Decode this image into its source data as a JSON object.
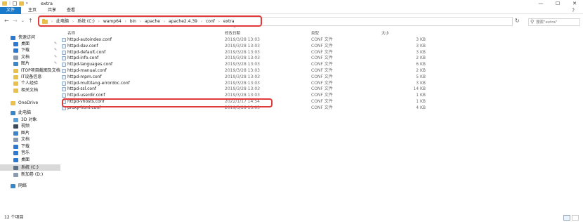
{
  "window": {
    "title": "extra",
    "buttons": {
      "minimize": "—",
      "maximize": "☐",
      "close": "✕"
    }
  },
  "ribbon": {
    "tabs": [
      "文件",
      "主页",
      "共享",
      "查看"
    ],
    "help": "?"
  },
  "nav": {
    "back": "←",
    "forward": "→",
    "dropdown": "⌄",
    "up": "↑",
    "refresh": "↻"
  },
  "address": {
    "crumbs": [
      "此电脑",
      "系统 (C:)",
      "wamp64",
      "bin",
      "apache",
      "apache2.4.39",
      "conf",
      "extra"
    ],
    "sep": "›"
  },
  "search": {
    "placeholder": "搜索\"extra\""
  },
  "sidebar": {
    "items": [
      {
        "label": "快速访问",
        "icon": "star-icon",
        "color": "#2b79d0",
        "pinned": false
      },
      {
        "label": "桌面",
        "icon": "desktop-icon",
        "color": "#2b79d0",
        "pinned": true
      },
      {
        "label": "下载",
        "icon": "download-icon",
        "color": "#2b79d0",
        "pinned": true
      },
      {
        "label": "文档",
        "icon": "document-icon",
        "color": "#8a9bb0",
        "pinned": true
      },
      {
        "label": "图片",
        "icon": "pictures-icon",
        "color": "#3a86c8",
        "pinned": true
      },
      {
        "label": "ITOP项目截图及文档",
        "icon": "folder-icon",
        "color": "#e8c04a",
        "pinned": false
      },
      {
        "label": "IT设备信息",
        "icon": "folder-icon",
        "color": "#e8c04a",
        "pinned": false
      },
      {
        "label": "个人经验",
        "icon": "folder-icon",
        "color": "#e8c04a",
        "pinned": false
      },
      {
        "label": "相关文档",
        "icon": "folder-icon",
        "color": "#e8c04a",
        "pinned": false
      },
      {
        "label": "OneDrive",
        "icon": "onedrive-icon",
        "color": "#e8c04a",
        "pinned": false
      },
      {
        "label": "此电脑",
        "icon": "computer-icon",
        "color": "#3a86c8",
        "pinned": false
      },
      {
        "label": "3D 对象",
        "icon": "3d-objects-icon",
        "color": "#5aa0d8",
        "pinned": false
      },
      {
        "label": "视频",
        "icon": "video-icon",
        "color": "#3b4b5c",
        "pinned": false
      },
      {
        "label": "图片",
        "icon": "pictures-icon",
        "color": "#3a86c8",
        "pinned": false
      },
      {
        "label": "文档",
        "icon": "document-icon",
        "color": "#8a9bb0",
        "pinned": false
      },
      {
        "label": "下载",
        "icon": "download-icon",
        "color": "#2b79d0",
        "pinned": false
      },
      {
        "label": "音乐",
        "icon": "music-icon",
        "color": "#2b79d0",
        "pinned": false
      },
      {
        "label": "桌面",
        "icon": "desktop-icon",
        "color": "#2b79d0",
        "pinned": false
      },
      {
        "label": "系统 (C:)",
        "icon": "drive-icon",
        "color": "#5b6f85",
        "pinned": false,
        "selected": true
      },
      {
        "label": "新加卷 (D:)",
        "icon": "drive-icon",
        "color": "#8a9bb0",
        "pinned": false
      },
      {
        "label": "网络",
        "icon": "network-icon",
        "color": "#3a86c8",
        "pinned": false
      }
    ]
  },
  "columns": {
    "name": "名称",
    "date": "修改日期",
    "type": "类型",
    "size": "大小",
    "sort": "^"
  },
  "files": [
    {
      "name": "httpd-autoindex.conf",
      "date": "2019/3/28 13:03",
      "type": "CONF 文件",
      "size": "3 KB"
    },
    {
      "name": "httpd-dav.conf",
      "date": "2019/3/28 13:03",
      "type": "CONF 文件",
      "size": "3 KB"
    },
    {
      "name": "httpd-default.conf",
      "date": "2019/3/28 13:03",
      "type": "CONF 文件",
      "size": "3 KB"
    },
    {
      "name": "httpd-info.conf",
      "date": "2019/3/28 13:03",
      "type": "CONF 文件",
      "size": "2 KB"
    },
    {
      "name": "httpd-languages.conf",
      "date": "2019/3/28 13:03",
      "type": "CONF 文件",
      "size": "6 KB"
    },
    {
      "name": "httpd-manual.conf",
      "date": "2019/3/28 13:03",
      "type": "CONF 文件",
      "size": "2 KB"
    },
    {
      "name": "httpd-mpm.conf",
      "date": "2019/3/28 13:03",
      "type": "CONF 文件",
      "size": "5 KB"
    },
    {
      "name": "httpd-multilang-errordoc.conf",
      "date": "2019/3/28 13:03",
      "type": "CONF 文件",
      "size": "3 KB"
    },
    {
      "name": "httpd-ssl.conf",
      "date": "2019/3/28 13:03",
      "type": "CONF 文件",
      "size": "14 KB"
    },
    {
      "name": "httpd-userdir.conf",
      "date": "2019/3/28 13:03",
      "type": "CONF 文件",
      "size": "1 KB"
    },
    {
      "name": "httpd-vhosts.conf",
      "date": "2022/1/17 14:54",
      "type": "CONF 文件",
      "size": "1 KB"
    },
    {
      "name": "proxy-html.conf",
      "date": "2019/3/28 13:03",
      "type": "CONF 文件",
      "size": "4 KB"
    }
  ],
  "status": {
    "count": "12 个项目"
  },
  "accent": {
    "file_tab": "#1979ca",
    "highlight": "#e03a3a"
  }
}
